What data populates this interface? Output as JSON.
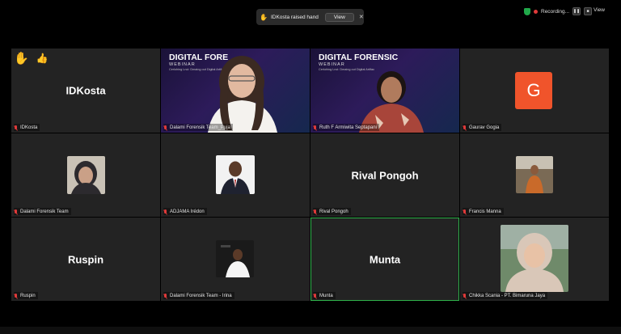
{
  "notification": {
    "text": "IDKosta raised hand",
    "view_button": "View"
  },
  "recording": {
    "label": "Recording..."
  },
  "top_view_label": "View",
  "reactions": [
    "✋",
    "👍"
  ],
  "webinar": {
    "title_left": "DIGITAL FORE",
    "title_right": "DIGITAL FORENSIC",
    "subtitle": "WEBINAR",
    "tagline": "Cerlohing Lnci: Dmaing out Digital Artifac"
  },
  "participants": [
    {
      "name": "IDKosta",
      "display": "IDKosta"
    },
    {
      "name": "Dalami Forensik Team_Puja"
    },
    {
      "name": "Ruth F Armiwita Septapani"
    },
    {
      "name": "Gaurav Gogia",
      "avatar_letter": "G"
    },
    {
      "name": "Dalami Forensik Team"
    },
    {
      "name": "ADJAMA Irédon"
    },
    {
      "name": "Rival Pongoh",
      "display": "Rival Pongoh"
    },
    {
      "name": "Francis Manna"
    },
    {
      "name": "Ruspin",
      "display": "Ruspin"
    },
    {
      "name": "Dalami Forensik Team - Irina"
    },
    {
      "name": "Munta",
      "display": "Munta"
    },
    {
      "name": "Chikka Scania - PT. Bimaruna Jaya"
    }
  ],
  "colors": {
    "tile_bg": "#232323",
    "active_speaker": "#2fb34b",
    "avatar_g": "#f0542b",
    "muted_mic": "#e03a3a"
  }
}
